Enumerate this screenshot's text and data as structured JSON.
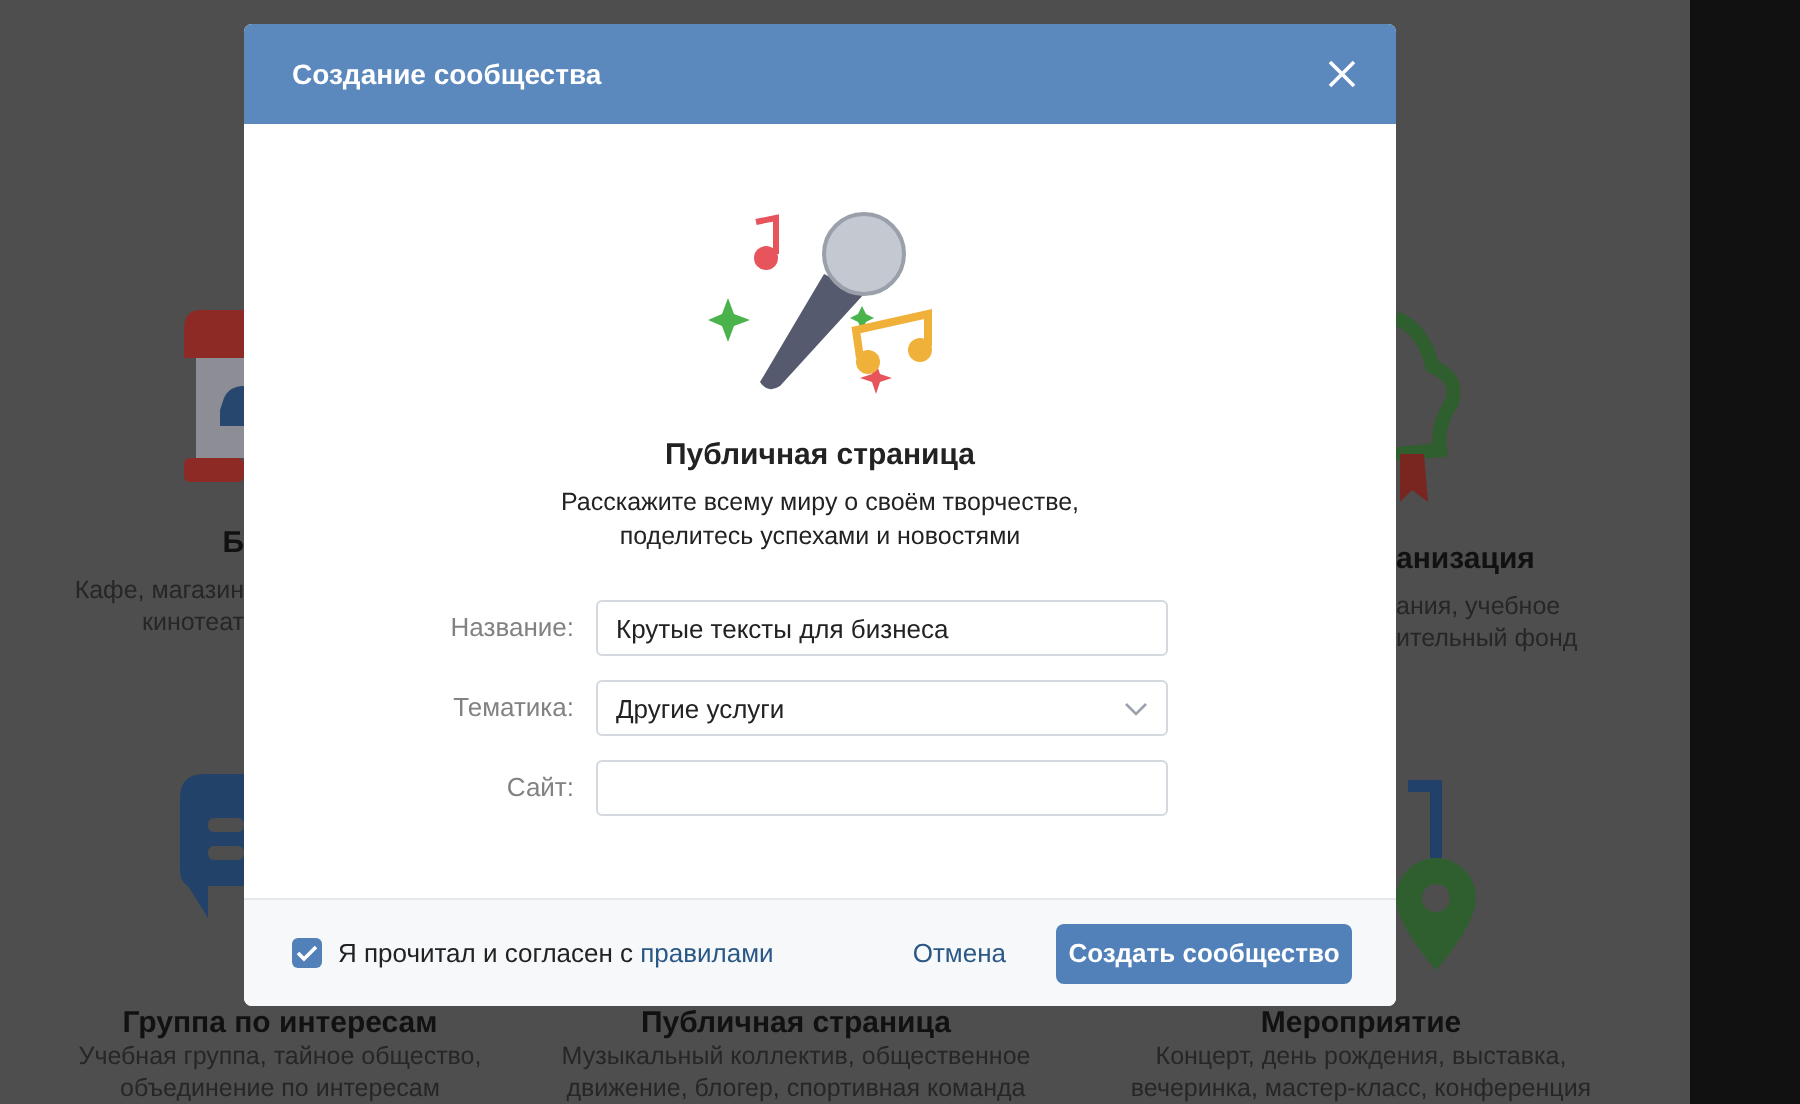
{
  "background": {
    "top_left": {
      "title": "Б",
      "lines": [
        "Кафе, магазин",
        "кинотеат"
      ]
    },
    "top_right": {
      "title": "анизация",
      "lines": [
        "ания, учебное",
        "ительный фонд"
      ]
    },
    "bottom": [
      {
        "title": "Группа по интересам",
        "lines": [
          "Учебная группа, тайное общество,",
          "объединение по интересам"
        ]
      },
      {
        "title": "Публичная страница",
        "lines": [
          "Музыкальный коллектив, общественное",
          "движение, блогер, спортивная команда"
        ]
      },
      {
        "title": "Мероприятие",
        "lines": [
          "Концерт, день рождения, выставка,",
          "вечеринка, мастер-класс, конференция"
        ]
      }
    ]
  },
  "dialog": {
    "title": "Создание сообщества",
    "heading": "Публичная страница",
    "description": [
      "Расскажите всему миру о своём творчестве,",
      "поделитесь успехами и новостями"
    ],
    "fields": [
      {
        "kind": "text",
        "label": "Название:",
        "value": "Крутые тексты для бизнеса"
      },
      {
        "kind": "select",
        "label": "Тематика:",
        "value": "Другие услуги"
      },
      {
        "kind": "text",
        "label": "Сайт:"
      }
    ],
    "agreement": {
      "checked": true,
      "text": "Я прочитал и согласен с",
      "link": "правилами"
    },
    "cancel": "Отмена",
    "submit": "Создать сообщество"
  }
}
